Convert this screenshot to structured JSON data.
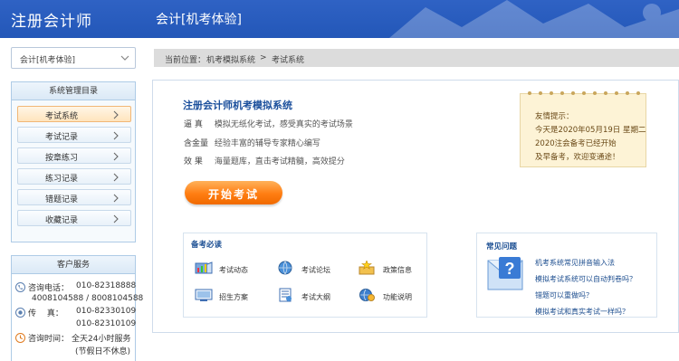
{
  "header": {
    "app_title": "注册会计师",
    "exam_title": "会计[机考体验]"
  },
  "mode_select": {
    "value": "会计[机考体验]"
  },
  "menu": {
    "title": "系统管理目录",
    "items": [
      {
        "label": "考试系统",
        "active": true
      },
      {
        "label": "考试记录"
      },
      {
        "label": "按章练习"
      },
      {
        "label": "练习记录"
      },
      {
        "label": "错题记录"
      },
      {
        "label": "收藏记录"
      }
    ]
  },
  "service": {
    "title": "客户服务",
    "phone_label": "咨询电话：",
    "phone_1": "010-82318888",
    "phone_2": "4008104588 / 8008104588",
    "fax_label": "传　 真：",
    "fax_1": "010-82330109",
    "fax_2": "010-82310109",
    "time_label": "咨询时间：",
    "time_1": "全天24小时服务",
    "time_2": "(节假日不休息)"
  },
  "breadcrumb": {
    "prefix": "当前位置：",
    "item_1": "机考模拟系统",
    "item_2": "考试系统"
  },
  "main": {
    "title": "注册会计师机考模拟系统",
    "features": [
      {
        "key": "逼 真",
        "text": "模拟无纸化考试，感受真实的考试场景"
      },
      {
        "key": "含金量",
        "text": "经验丰富的辅导专家精心编写"
      },
      {
        "key": "效 果",
        "text": "海量题库，直击考试精髓，高效提分"
      }
    ],
    "start_button": "开始考试"
  },
  "tip": {
    "title": "友情提示：",
    "line_1": "今天是2020年05月19日 星期二",
    "line_2": "2020注会备考已经开始",
    "line_3": "及早备考，欢迎变通途！"
  },
  "prep": {
    "title": "备考必读",
    "items": [
      {
        "label": "考试动态",
        "icon": "chart-book-icon"
      },
      {
        "label": "考试论坛",
        "icon": "globe-icon"
      },
      {
        "label": "政策信息",
        "icon": "stars-icon"
      },
      {
        "label": "招生方案",
        "icon": "screen-icon"
      },
      {
        "label": "考试大纲",
        "icon": "document-icon"
      },
      {
        "label": "功能说明",
        "icon": "gear-globe-icon"
      }
    ]
  },
  "faq": {
    "title": "常见问题",
    "questions": [
      "机考系统常见拼音输入法",
      "模拟考试系统可以自动判卷吗？",
      "错题可以重做吗？",
      "模拟考试和真实考试一样吗？"
    ]
  },
  "colors": {
    "header_blue": "#2357b8",
    "accent_orange": "#ff7d12",
    "title_blue": "#1b4f9c"
  }
}
